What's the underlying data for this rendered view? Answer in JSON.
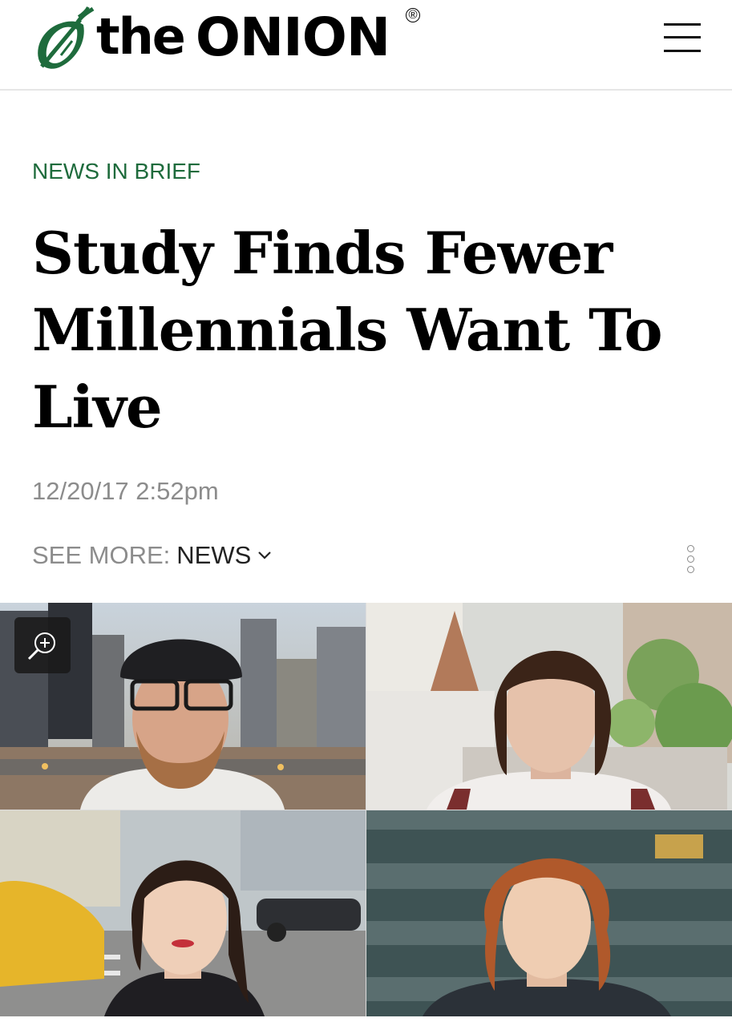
{
  "header": {
    "logo_word_1": "the",
    "logo_word_2": "ONION",
    "logo_mark": "®",
    "logo_icon": "onion-icon",
    "menu_icon": "hamburger-menu-icon",
    "accent_color": "#1e6b3c"
  },
  "article": {
    "kicker": "NEWS IN BRIEF",
    "headline": "Study Finds Fewer Millennials Want To Live",
    "timestamp": "12/20/17 2:52pm",
    "see_more_label": "SEE MORE:",
    "see_more_link": "NEWS",
    "more_options_icon": "vertical-ellipsis-icon"
  },
  "image": {
    "zoom_icon": "zoom-in-icon"
  }
}
